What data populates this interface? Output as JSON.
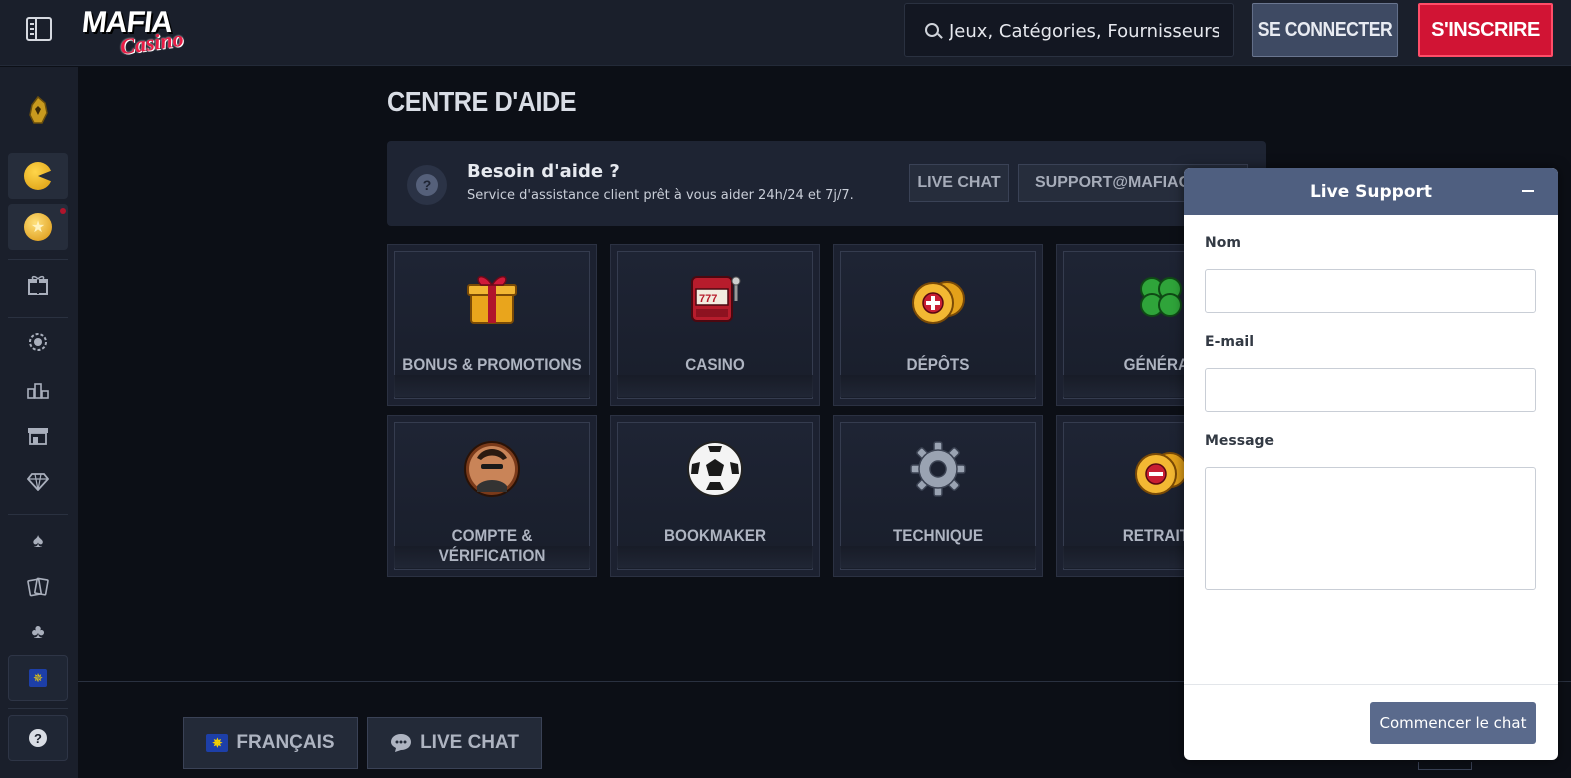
{
  "header": {
    "logo_top": "MAFIA",
    "logo_bottom": "Casino",
    "search_placeholder": "Jeux, Catégories, Fournisseurs",
    "login_label": "SE CONNECTER",
    "signup_label": "S'INSCRIRE"
  },
  "sidebar": {
    "items": [
      {
        "name": "lion-emblem-icon"
      },
      {
        "name": "pacman-coin-icon"
      },
      {
        "name": "star-coin-icon"
      },
      {
        "name": "gift-icon"
      },
      {
        "name": "badge-icon"
      },
      {
        "name": "podium-icon"
      },
      {
        "name": "shop-icon"
      },
      {
        "name": "diamond-icon"
      },
      {
        "name": "spade-icon"
      },
      {
        "name": "cards-icon"
      },
      {
        "name": "clover-icon"
      },
      {
        "name": "eu-flag-icon"
      },
      {
        "name": "help-icon"
      }
    ]
  },
  "main": {
    "title": "CENTRE D'AIDE",
    "banner": {
      "title": "Besoin d'aide ?",
      "subtitle": "Service d'assistance client prêt à vous aider 24h/24 et 7j/7.",
      "live_chat": "LIVE CHAT",
      "email": "SUPPORT@MAFIACASINO.COM"
    },
    "categories": [
      {
        "label": "BONUS & PROMOTIONS",
        "icon": "gift-box-icon"
      },
      {
        "label": "CASINO",
        "icon": "slot-machine-icon"
      },
      {
        "label": "DÉPÔTS",
        "icon": "coins-plus-icon"
      },
      {
        "label": "GÉNÉRAL",
        "icon": "four-leaf-clover-icon"
      },
      {
        "label": "COMPTE & VÉRIFICATION",
        "icon": "mafia-avatar-icon"
      },
      {
        "label": "BOOKMAKER",
        "icon": "soccer-ball-icon"
      },
      {
        "label": "TECHNIQUE",
        "icon": "gear-icon"
      },
      {
        "label": "RETRAITS",
        "icon": "coins-minus-icon"
      }
    ]
  },
  "footer": {
    "language": "FRANÇAIS",
    "live_chat": "LIVE CHAT"
  },
  "widget": {
    "title": "Live Support",
    "name_label": "Nom",
    "email_label": "E-mail",
    "message_label": "Message",
    "start_button": "Commencer le chat"
  },
  "colors": {
    "background": "#0c0f16",
    "topbar": "#1a1f2b",
    "signup": "#d11434",
    "login": "#3e4a63",
    "widget_header": "#4f5f80"
  }
}
